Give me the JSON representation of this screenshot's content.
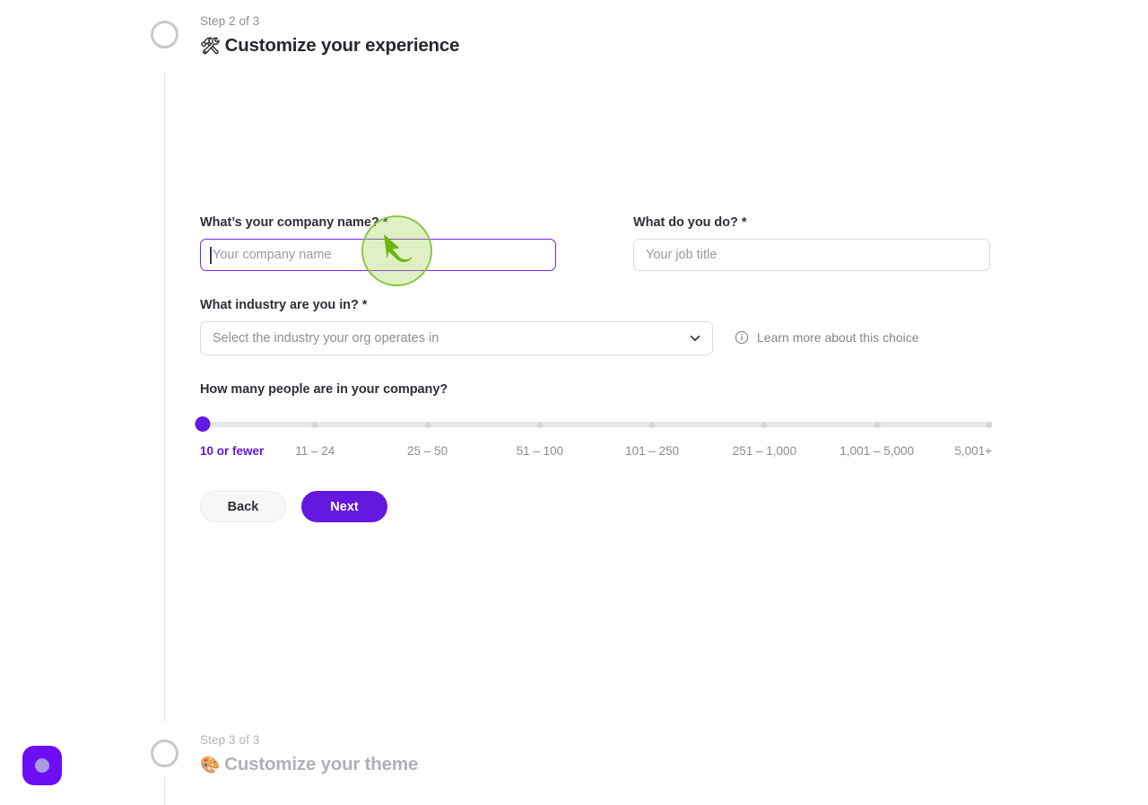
{
  "steps": {
    "current": {
      "kicker": "Step 2 of 3",
      "emoji": "🛠",
      "title": "Customize your experience"
    },
    "next": {
      "kicker": "Step 3 of 3",
      "emoji": "🎨",
      "title": "Customize your theme"
    }
  },
  "form": {
    "company": {
      "label": "What’s your company name? *",
      "placeholder": "Your company name",
      "value": ""
    },
    "job": {
      "label": "What do you do? *",
      "placeholder": "Your job title",
      "value": ""
    },
    "industry": {
      "label": "What industry are you in? *",
      "placeholder": "Select the industry your org operates in",
      "value": "",
      "chevron_icon": "chevron-down-icon",
      "helper": {
        "icon": "info-circle-icon",
        "text": "Learn more about this choice"
      }
    },
    "company_size": {
      "label": "How many people are in your company?",
      "selected_index": 0,
      "options": [
        "10 or fewer",
        "11 – 24",
        "25 – 50",
        "51 – 100",
        "101 – 250",
        "251 – 1,000",
        "1,001 – 5,000",
        "5,001+"
      ]
    }
  },
  "actions": {
    "back_label": "Back",
    "next_label": "Next"
  },
  "colors": {
    "accent": "#6418e0",
    "focus_border": "#7528e8",
    "cursor_highlight": "#8cc63f",
    "fab": "#6d0ef5"
  },
  "overlay": {
    "cursor_icon": "mouse-cursor-arrow-icon"
  }
}
